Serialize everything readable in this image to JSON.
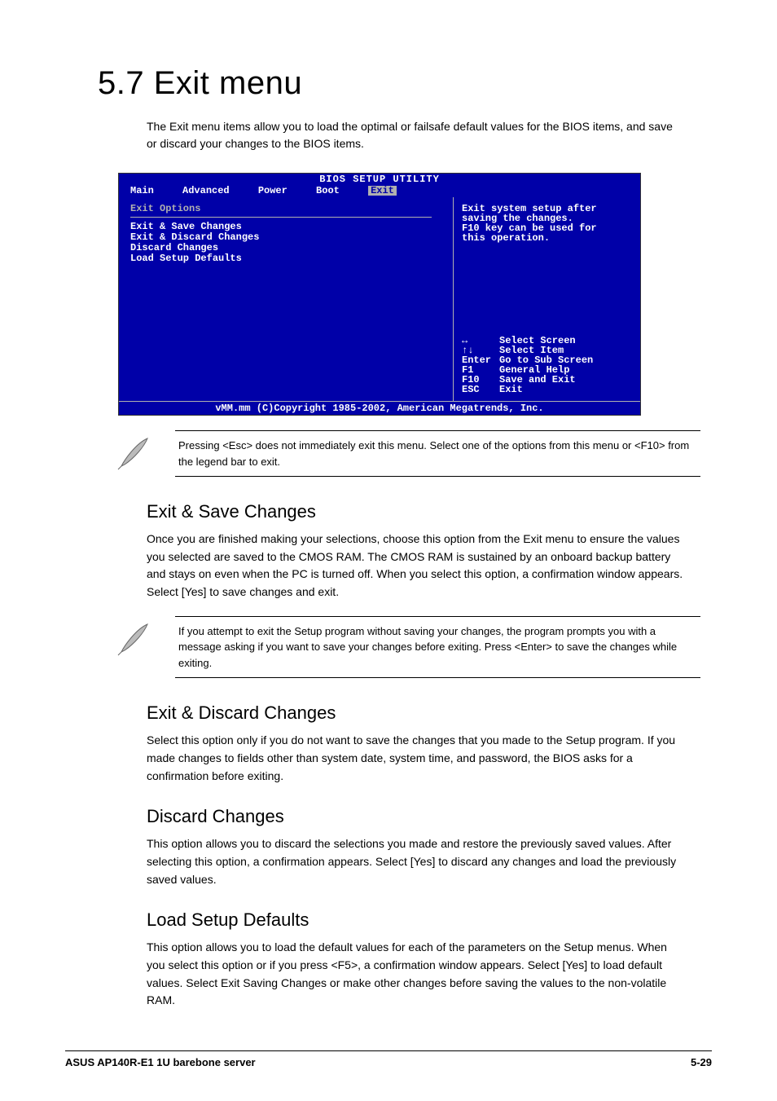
{
  "heading": "5.7    Exit menu",
  "intro": "The Exit menu items allow you to load the optimal or failsafe default values for the BIOS items, and save or discard your changes to the BIOS items.",
  "bios": {
    "title": "BIOS SETUP UTILITY",
    "tabs": [
      "Main",
      "Advanced",
      "Power",
      "Boot",
      "Exit"
    ],
    "tab_selected": "Exit",
    "options_header": "Exit Options",
    "items": [
      "Exit & Save Changes",
      "Exit & Discard Changes",
      "Discard Changes",
      "",
      "Load Setup Defaults"
    ],
    "help_lines": [
      "Exit system setup after",
      "saving the changes.",
      "",
      "F10 key can be used for",
      "this operation."
    ],
    "keys": [
      {
        "k": "↔",
        "d": "Select Screen"
      },
      {
        "k": "↑↓",
        "d": "Select Item"
      },
      {
        "k": "Enter",
        "d": "Go to Sub Screen"
      },
      {
        "k": "F1",
        "d": "General Help"
      },
      {
        "k": "F10",
        "d": "Save and Exit"
      },
      {
        "k": "ESC",
        "d": "Exit"
      }
    ],
    "footer": "vMM.mm (C)Copyright 1985-2002, American Megatrends, Inc."
  },
  "note1": "Pressing <Esc> does not immediately exit this menu. Select one of the options from this menu or <F10> from the legend bar to exit.",
  "sub1_title": "Exit & Save Changes",
  "sub1_body": "Once you are finished making your selections, choose this option from the Exit menu to ensure the values you selected are saved to the CMOS RAM. The CMOS RAM is sustained by an onboard backup battery and stays on even when the PC is turned off. When you select this option, a confirmation window appears. Select [Yes] to save changes and exit.",
  "note2": "If you attempt to exit the Setup program without saving your changes, the program prompts you with a message asking if you want to save your changes before exiting. Press <Enter> to save the changes while exiting.",
  "sub2_title": "Exit & Discard Changes",
  "sub2_body": "Select this option only if you do not want to save the changes that you made to the Setup program. If you made changes to fields other than system date, system time, and password, the BIOS asks for a confirmation before exiting.",
  "sub3_title": "Discard Changes",
  "sub3_body": "This option allows you to discard the selections you made and restore the previously saved values. After selecting this option, a confirmation appears. Select [Yes] to discard any changes and load the previously saved values.",
  "sub4_title": "Load Setup Defaults",
  "sub4_body": "This option allows you to load the default values for each of the parameters on the Setup menus. When you select this option or if you press <F5>, a confirmation window appears. Select [Yes] to load default values. Select Exit Saving Changes or make other changes before saving the values to the non-volatile RAM.",
  "footer_ref": "ASUS AP140R-E1 1U barebone server",
  "footer_page": "5-29"
}
